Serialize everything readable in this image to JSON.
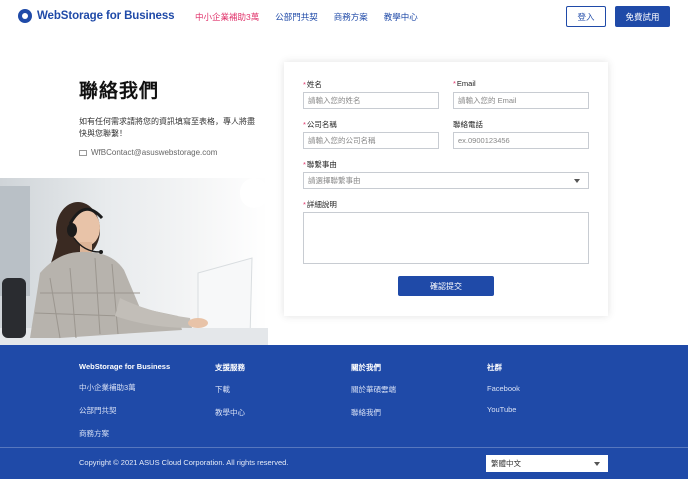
{
  "header": {
    "logo": "WebStorage for Business",
    "nav": [
      "中小企業補助3萬",
      "公部門共契",
      "商務方案",
      "教學中心"
    ],
    "login": "登入",
    "trial": "免費試用"
  },
  "hero": {
    "title": "聯絡我們",
    "desc": "如有任何需求請將您的資訊填寫至表格，專人將盡快與您聯繫！",
    "email": "WfBContact@asuswebstorage.com"
  },
  "form": {
    "name_label": "姓名",
    "name_placeholder": "請輸入您的姓名",
    "email_label": "Email",
    "email_placeholder": "請輸入您的 Email",
    "company_label": "公司名稱",
    "company_placeholder": "請輸入您的公司名稱",
    "phone_label": "聯絡電話",
    "phone_placeholder": "ex.0900123456",
    "reason_label": "聯繫事由",
    "reason_value": "請選擇聯繫事由",
    "detail_label": "詳細說明",
    "submit": "確認提交",
    "required_mark": "*"
  },
  "footer": {
    "columns": [
      {
        "head": "WebStorage for Business",
        "items": [
          "中小企業補助3萬",
          "公部門共契",
          "商務方案"
        ]
      },
      {
        "head": "支援服務",
        "items": [
          "下載",
          "教學中心"
        ]
      },
      {
        "head": "關於我們",
        "items": [
          "關於華碩雲端",
          "聯絡我們"
        ]
      },
      {
        "head": "社群",
        "items": [
          "Facebook",
          "YouTube"
        ]
      }
    ],
    "copyright": "Copyright © 2021 ASUS Cloud Corporation. All rights reserved.",
    "language": "繁體中文"
  },
  "colors": {
    "brand": "#1f4aa8",
    "accent": "#e0336b"
  }
}
